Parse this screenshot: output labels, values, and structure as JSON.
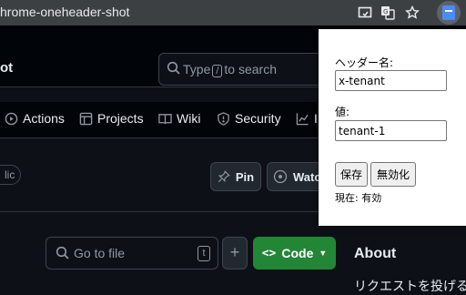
{
  "browser": {
    "address_text": "hrome-oneheader-shot",
    "toolbar_icons": [
      "cast-icon",
      "translate-icon",
      "bookmark-star-icon",
      "extension-icon"
    ]
  },
  "github": {
    "repo_name_fragment": "ot",
    "search": {
      "prefix": "Type",
      "key": "/",
      "suffix": "to search"
    },
    "nav": {
      "actions": "Actions",
      "projects": "Projects",
      "wiki": "Wiki",
      "security": "Security",
      "insights_fragment": "I"
    },
    "visibility_badge_fragment": "lic",
    "pin_label": "Pin",
    "watch_label": "Watch",
    "goto_file_placeholder": "Go to file",
    "goto_file_key": "t",
    "add_file_label": "+",
    "code_label": "Code",
    "code_color": "#238636",
    "about_title": "About",
    "about_desc_fragment": "リクエストを投げるヘ"
  },
  "popup": {
    "header_name_label": "ヘッダー名:",
    "header_name_value": "x-tenant",
    "value_label": "値:",
    "value_value": "tenant-1",
    "save_label": "保存",
    "disable_label": "無効化",
    "status_text": "現在: 有効"
  }
}
